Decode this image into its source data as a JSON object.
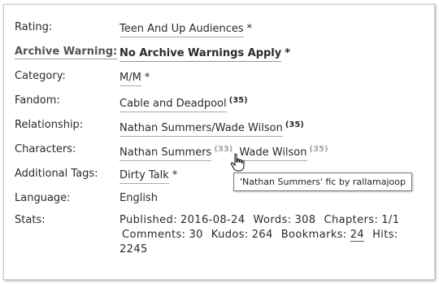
{
  "rows": {
    "rating": {
      "label": "Rating:",
      "value": "Teen And Up Audiences",
      "star": "*"
    },
    "warning": {
      "label": "Archive Warning:",
      "value": "No Archive Warnings Apply",
      "star": "*"
    },
    "category": {
      "label": "Category:",
      "value": "M/M",
      "star": "*"
    },
    "fandom": {
      "label": "Fandom:",
      "value": "Cable and Deadpool",
      "count": "(35)"
    },
    "relationship": {
      "label": "Relationship:",
      "value": "Nathan Summers/Wade Wilson",
      "count": "(35)"
    },
    "characters": {
      "label": "Characters:",
      "items": [
        {
          "name": "Nathan Summers",
          "count": "(33)"
        },
        {
          "name": "Wade Wilson",
          "count": "(35)"
        }
      ]
    },
    "tags": {
      "label": "Additional Tags:",
      "value": "Dirty Talk",
      "star": "*"
    },
    "language": {
      "label": "Language:",
      "value": "English"
    },
    "stats": {
      "label": "Stats:",
      "published_label": "Published:",
      "published": "2016-08-24",
      "words_label": "Words:",
      "words": "308",
      "chapters_label": "Chapters:",
      "chapters": "1/1",
      "comments_label": "Comments:",
      "comments": "30",
      "kudos_label": "Kudos:",
      "kudos": "264",
      "bookmarks_label": "Bookmarks:",
      "bookmarks": "24",
      "hits_label": "Hits:",
      "hits": "2245"
    }
  },
  "tooltip": "'Nathan Summers' fic by rallamajoop",
  "icons": {
    "cursor": "hand-pointer-icon"
  }
}
